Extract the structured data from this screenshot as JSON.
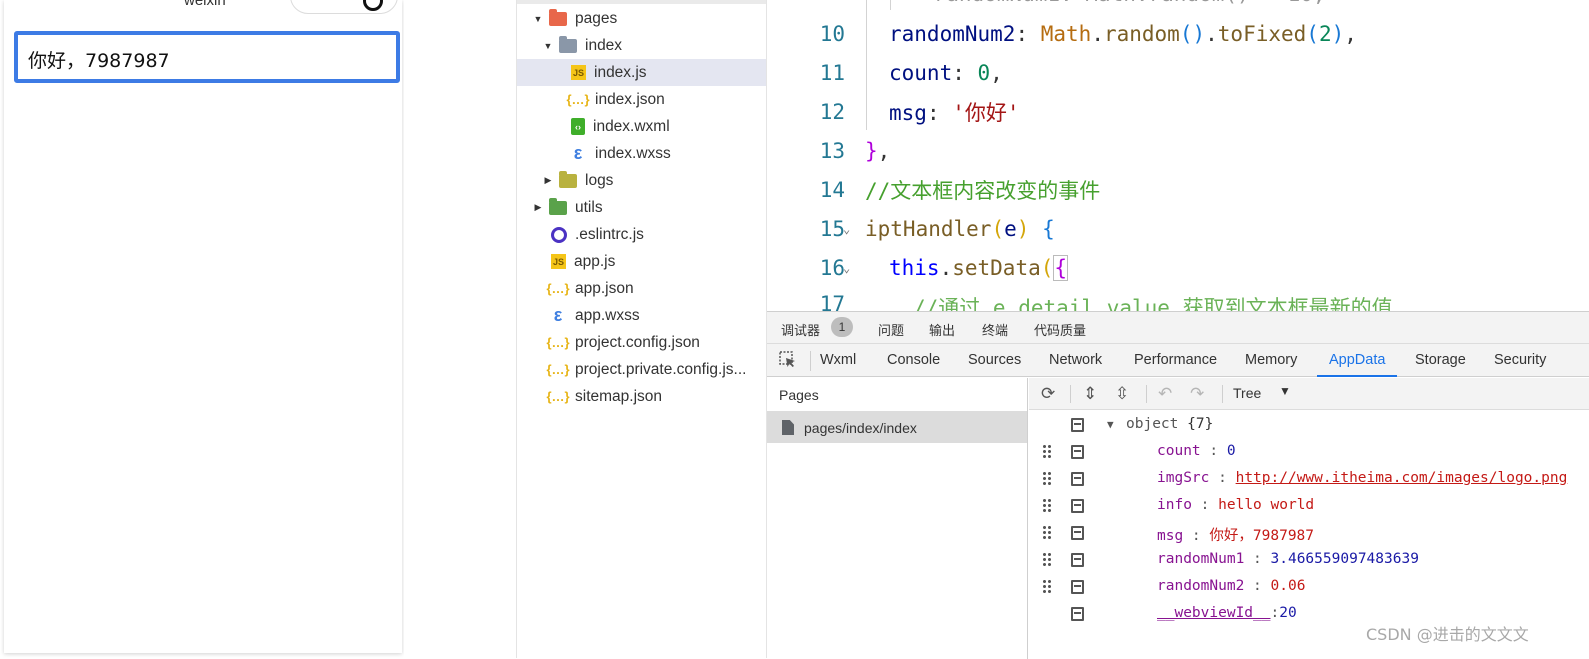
{
  "simulator": {
    "nav_title": "weixin",
    "input_value": "你好，7987987"
  },
  "file_tree": {
    "items": [
      {
        "label": "pages",
        "type": "folder",
        "color": "#e8674a",
        "expanded": true
      },
      {
        "label": "index",
        "type": "folder",
        "color": "#8a97a8",
        "expanded": true
      },
      {
        "label": "index.js",
        "type": "js"
      },
      {
        "label": "index.json",
        "type": "json"
      },
      {
        "label": "index.wxml",
        "type": "wxml"
      },
      {
        "label": "index.wxss",
        "type": "wxss"
      },
      {
        "label": "logs",
        "type": "folder",
        "color": "#b9b23f",
        "expanded": false
      },
      {
        "label": "utils",
        "type": "folder",
        "color": "#5aa24a",
        "expanded": false
      },
      {
        "label": ".eslintrc.js",
        "type": "eslint"
      },
      {
        "label": "app.js",
        "type": "js"
      },
      {
        "label": "app.json",
        "type": "json"
      },
      {
        "label": "app.wxss",
        "type": "wxss"
      },
      {
        "label": "project.config.json",
        "type": "json"
      },
      {
        "label": "project.private.config.js...",
        "type": "json"
      },
      {
        "label": "sitemap.json",
        "type": "json"
      }
    ],
    "selected": "index.js"
  },
  "editor": {
    "lines": [
      {
        "num": "10",
        "text": "randomNum2: Math.random().toFixed(2),"
      },
      {
        "num": "11",
        "text": "count: 0,"
      },
      {
        "num": "12",
        "text": "msg: '你好'"
      },
      {
        "num": "13",
        "text": "},"
      },
      {
        "num": "14",
        "text": "//文本框内容改变的事件"
      },
      {
        "num": "15",
        "text": "iptHandler(e) {"
      },
      {
        "num": "16",
        "text": "this.setData({"
      }
    ]
  },
  "devtools": {
    "top_tabs": [
      "调试器",
      "问题",
      "输出",
      "终端",
      "代码质量"
    ],
    "debugger_badge": "1",
    "main_tabs": [
      "Wxml",
      "Console",
      "Sources",
      "Network",
      "Performance",
      "Memory",
      "AppData",
      "Storage",
      "Security"
    ],
    "active_tab": "AppData",
    "pages_header": "Pages",
    "page_item": "pages/index/index",
    "view_mode": "Tree",
    "object_label": "object",
    "object_count": "{7}",
    "entries": [
      {
        "key": "count",
        "value": "0",
        "kind": "num"
      },
      {
        "key": "imgSrc",
        "value": "http://www.itheima.com/images/logo.png",
        "kind": "link"
      },
      {
        "key": "info",
        "value": "hello world",
        "kind": "str"
      },
      {
        "key": "msg",
        "value": "你好，7987987",
        "kind": "str"
      },
      {
        "key": "randomNum1",
        "value": "3.466559097483639",
        "kind": "num"
      },
      {
        "key": "randomNum2",
        "value": "0.06",
        "kind": "str"
      },
      {
        "key": "__webviewId__",
        "value": "20",
        "kind": "num"
      }
    ]
  },
  "watermark": "CSDN @进击的文文文",
  "colors": {
    "accent": "#1a73e8",
    "input_border": "#3d7be5"
  }
}
